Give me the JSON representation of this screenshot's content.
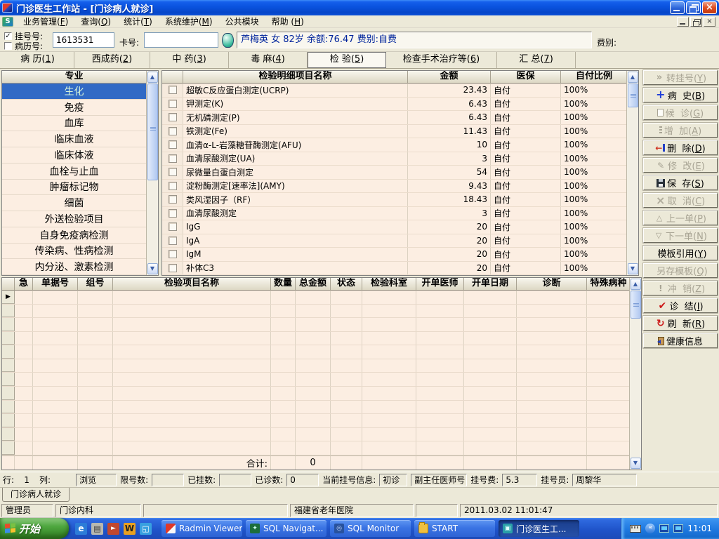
{
  "window": {
    "title": "门诊医生工作站 - [门诊病人就诊]"
  },
  "menu": {
    "items": [
      "业务管理(F)",
      "查询(Q)",
      "统计(T)",
      "系统维护(M)",
      "公共模块",
      "帮助 (H)"
    ]
  },
  "patient_bar": {
    "reg_checkbox_label": "挂号号:",
    "record_checkbox_label": "病历号:",
    "reg_no": "1613531",
    "card_label": "卡号:",
    "card_no": "",
    "patient_info": "芦梅英 女 82岁 余额:76.47 费别:自费",
    "fee_type_label": "费别:"
  },
  "tabs": [
    {
      "label": "病 历(1)",
      "active": false
    },
    {
      "label": "西成药(2)",
      "active": false
    },
    {
      "label": "中 药(3)",
      "active": false
    },
    {
      "label": "毒 麻(4)",
      "active": false
    },
    {
      "label": "检 验(5)",
      "active": true
    },
    {
      "label": "检查手术治疗等(6)",
      "active": false
    },
    {
      "label": "汇 总(7)",
      "active": false
    }
  ],
  "sidebar": {
    "header": "专业",
    "selected_index": 0,
    "items": [
      "生化",
      "免疫",
      "血库",
      "临床血液",
      "临床体液",
      "血栓与止血",
      "肿瘤标记物",
      "细菌",
      "外送检验项目",
      "自身免疫病检测",
      "传染病、性病检测",
      "内分泌、激素检测"
    ]
  },
  "main_grid": {
    "columns": [
      "",
      "检验明细项目名称",
      "金额",
      "医保",
      "自付比例"
    ],
    "rows": [
      {
        "name": "超敏C反应蛋白测定(UCRP)",
        "amount": "23.43",
        "insurance": "自付",
        "self_ratio": "100%"
      },
      {
        "name": "钾测定(K)",
        "amount": "6.43",
        "insurance": "自付",
        "self_ratio": "100%"
      },
      {
        "name": "无机磷测定(P)",
        "amount": "6.43",
        "insurance": "自付",
        "self_ratio": "100%"
      },
      {
        "name": "铁测定(Fe)",
        "amount": "11.43",
        "insurance": "自付",
        "self_ratio": "100%"
      },
      {
        "name": "血清α-L-岩藻糖苷酶测定(AFU)",
        "amount": "10",
        "insurance": "自付",
        "self_ratio": "100%"
      },
      {
        "name": "血清尿酸测定(UA)",
        "amount": "3",
        "insurance": "自付",
        "self_ratio": "100%"
      },
      {
        "name": "尿微量白蛋白测定",
        "amount": "54",
        "insurance": "自付",
        "self_ratio": "100%"
      },
      {
        "name": "淀粉酶测定[速率法](AMY)",
        "amount": "9.43",
        "insurance": "自付",
        "self_ratio": "100%"
      },
      {
        "name": "类风湿因子（RF）",
        "amount": "18.43",
        "insurance": "自付",
        "self_ratio": "100%"
      },
      {
        "name": "血清尿酸测定",
        "amount": "3",
        "insurance": "自付",
        "self_ratio": "100%"
      },
      {
        "name": "IgG",
        "amount": "20",
        "insurance": "自付",
        "self_ratio": "100%"
      },
      {
        "name": "IgA",
        "amount": "20",
        "insurance": "自付",
        "self_ratio": "100%"
      },
      {
        "name": "IgM",
        "amount": "20",
        "insurance": "自付",
        "self_ratio": "100%"
      },
      {
        "name": "补体C3",
        "amount": "20",
        "insurance": "自付",
        "self_ratio": "100%"
      }
    ]
  },
  "action_buttons": [
    {
      "name": "transfer-reg-button",
      "label": "转挂号(Y)",
      "icon": "chevr",
      "icon_name": "double-chevron-icon",
      "enabled": false
    },
    {
      "name": "history-button",
      "label": "病  史(B)",
      "icon": "plus",
      "icon_name": "plus-icon",
      "enabled": true
    },
    {
      "name": "waiting-button",
      "label": "候  诊(G)",
      "icon": "page",
      "icon_name": "document-icon",
      "enabled": false
    },
    {
      "name": "add-button",
      "label": "增  加(A)",
      "icon": "dots",
      "icon_name": "add-rows-icon",
      "enabled": false
    },
    {
      "name": "delete-button",
      "label": "删  除(D)",
      "icon": "del",
      "icon_name": "delete-arrow-icon",
      "enabled": true
    },
    {
      "name": "modify-button",
      "label": "修  改(E)",
      "icon": "edit",
      "icon_name": "pencil-icon",
      "enabled": false
    },
    {
      "name": "save-button",
      "label": "保  存(S)",
      "icon": "save",
      "icon_name": "floppy-disk-icon",
      "enabled": true
    },
    {
      "name": "cancel-button",
      "label": "取  消(C)",
      "icon": "cancel",
      "icon_name": "x-icon",
      "enabled": false
    },
    {
      "name": "prev-order-button",
      "label": "上一单(P)",
      "icon": "up",
      "icon_name": "up-triangle-icon",
      "enabled": false
    },
    {
      "name": "next-order-button",
      "label": "下一单(N)",
      "icon": "down",
      "icon_name": "down-triangle-icon",
      "enabled": false
    },
    {
      "name": "template-ref-button",
      "label": "模板引用(Y)",
      "icon": "none",
      "icon_name": "",
      "enabled": true
    },
    {
      "name": "save-template-button",
      "label": "另存模板(Q)",
      "icon": "none",
      "icon_name": "",
      "enabled": false
    },
    {
      "name": "reverse-button",
      "label": "冲  销(Z)",
      "icon": "excl",
      "icon_name": "exclamation-icon",
      "enabled": false
    },
    {
      "name": "diagnose-end-button",
      "label": "诊  结(I)",
      "icon": "check",
      "icon_name": "red-check-icon",
      "enabled": true
    },
    {
      "name": "refresh-button",
      "label": "刷  新(R)",
      "icon": "refresh",
      "icon_name": "refresh-icon",
      "enabled": true
    },
    {
      "name": "health-info-button",
      "label": "健康信息",
      "icon": "door",
      "icon_name": "door-exit-icon",
      "enabled": true
    }
  ],
  "bottom_grid": {
    "columns": [
      "",
      "急",
      "单据号",
      "组号",
      "检验项目名称",
      "数量",
      "总金额",
      "状态",
      "检验科室",
      "开单医师",
      "开单日期",
      "诊断",
      "特殊病种"
    ],
    "empty_row_count": 12,
    "footer": {
      "label": "合计:",
      "total": "0"
    }
  },
  "status_bar": {
    "row_label": "行:",
    "row_value": "1",
    "col_label": "列:",
    "col_value": "",
    "mode": "浏览",
    "limit_label": "限号数:",
    "limit_value": "",
    "registered_label": "已挂数:",
    "registered_value": "",
    "seen_label": "已诊数:",
    "seen_value": "0",
    "current_reg_label": "当前挂号信息:",
    "visit_type": "初诊",
    "doctor_title": "副主任医师号",
    "reg_fee_label": "挂号费:",
    "reg_fee_value": "5.3",
    "registrar_label": "挂号员:",
    "registrar_value": "周黎华"
  },
  "doc_tab": {
    "label": "门诊病人就诊"
  },
  "status_bar2": {
    "role": "管理员",
    "dept": "门诊内科",
    "hospital": "福建省老年医院",
    "datetime": "2011.03.02 11:01:47"
  },
  "taskbar": {
    "start_label": "开始",
    "quick_launch": [
      "ie-icon",
      "documents-icon",
      "media-player-icon",
      "winamp-icon",
      "show-desktop-icon"
    ],
    "tasks": [
      {
        "label": "Radmin Viewer",
        "icon": "radmin",
        "active": false
      },
      {
        "label": "SQL Navigat...",
        "icon": "sqlnav",
        "active": false
      },
      {
        "label": "SQL Monitor",
        "icon": "sqlmon",
        "active": false
      },
      {
        "label": "START",
        "icon": "folder",
        "active": false
      },
      {
        "label": "门诊医生工...",
        "icon": "meddoc",
        "active": true
      }
    ],
    "clock": "11:01"
  },
  "colors": {
    "titlebar_blue": "#0A52DE",
    "selection_blue": "#316AC5",
    "grid_row_bg": "#FCEEE2",
    "chrome_beige": "#ECE9D8",
    "taskbar_blue": "#1E52C8",
    "start_green": "#4EA73F",
    "patient_text_navy": "#00249C"
  }
}
